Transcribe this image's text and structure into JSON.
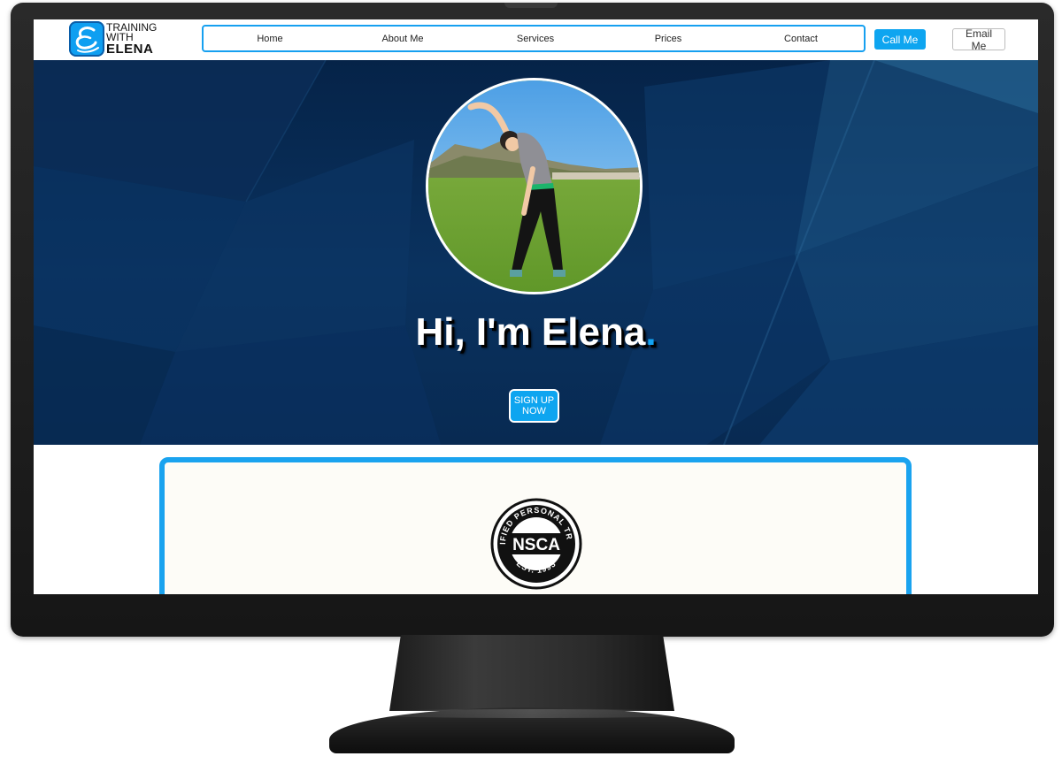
{
  "brand": {
    "logo_line1": "TRAINING",
    "logo_line2": "WITH",
    "logo_line3": "ELENA",
    "accent_color": "#0ea5f0"
  },
  "nav": {
    "items": [
      {
        "label": "Home"
      },
      {
        "label": "About Me"
      },
      {
        "label": "Services"
      },
      {
        "label": "Prices"
      },
      {
        "label": "Contact"
      }
    ],
    "call_label": "Call Me",
    "email_label": "Email Me"
  },
  "hero": {
    "title": "Hi, I'm Elena",
    "title_dot": ".",
    "cta_label": "SIGN UP NOW",
    "background_color": "#052348"
  },
  "certification": {
    "seal_center": "NSCA",
    "seal_top": "CERTIFIED PERSONAL TRAINER",
    "seal_bottom": "EST. 1993"
  }
}
